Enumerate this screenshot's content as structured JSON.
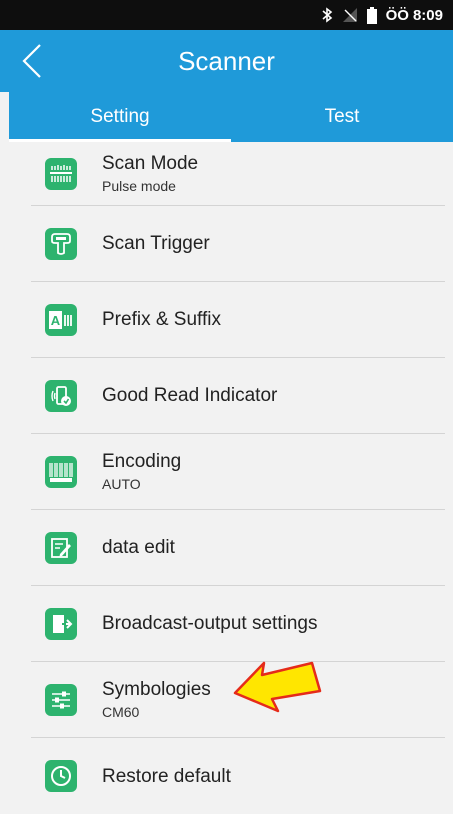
{
  "status_bar": {
    "time": "8:09",
    "carrier_text": "ÖÖ",
    "icons": [
      "bluetooth-icon",
      "no-signal-icon",
      "battery-icon"
    ]
  },
  "app_bar": {
    "title": "Scanner",
    "back_icon": "chevron-left-icon",
    "color": "#1f9ad9"
  },
  "tabs": [
    {
      "label": "Setting",
      "active": true
    },
    {
      "label": "Test",
      "active": false
    }
  ],
  "settings": [
    {
      "title": "Scan Mode",
      "subtitle": "Pulse mode",
      "icon": "scan-mode-icon"
    },
    {
      "title": "Scan Trigger",
      "icon": "scan-trigger-icon"
    },
    {
      "title": "Prefix & Suffix",
      "icon": "prefix-suffix-icon"
    },
    {
      "title": "Good Read Indicator",
      "icon": "good-read-indicator-icon"
    },
    {
      "title": "Encoding",
      "subtitle": "AUTO",
      "icon": "barcode-icon"
    },
    {
      "title": "data edit",
      "icon": "data-edit-icon"
    },
    {
      "title": "Broadcast-output settings",
      "icon": "broadcast-output-icon"
    },
    {
      "title": "Symbologies",
      "subtitle": "CM60",
      "icon": "symbologies-icon"
    },
    {
      "title": "Restore default",
      "icon": "clock-icon"
    }
  ],
  "colors": {
    "icon_green": "#2db36e",
    "annotation_arrow": "#ffe600"
  },
  "annotation": {
    "type": "arrow",
    "points_to": "Symbologies"
  }
}
